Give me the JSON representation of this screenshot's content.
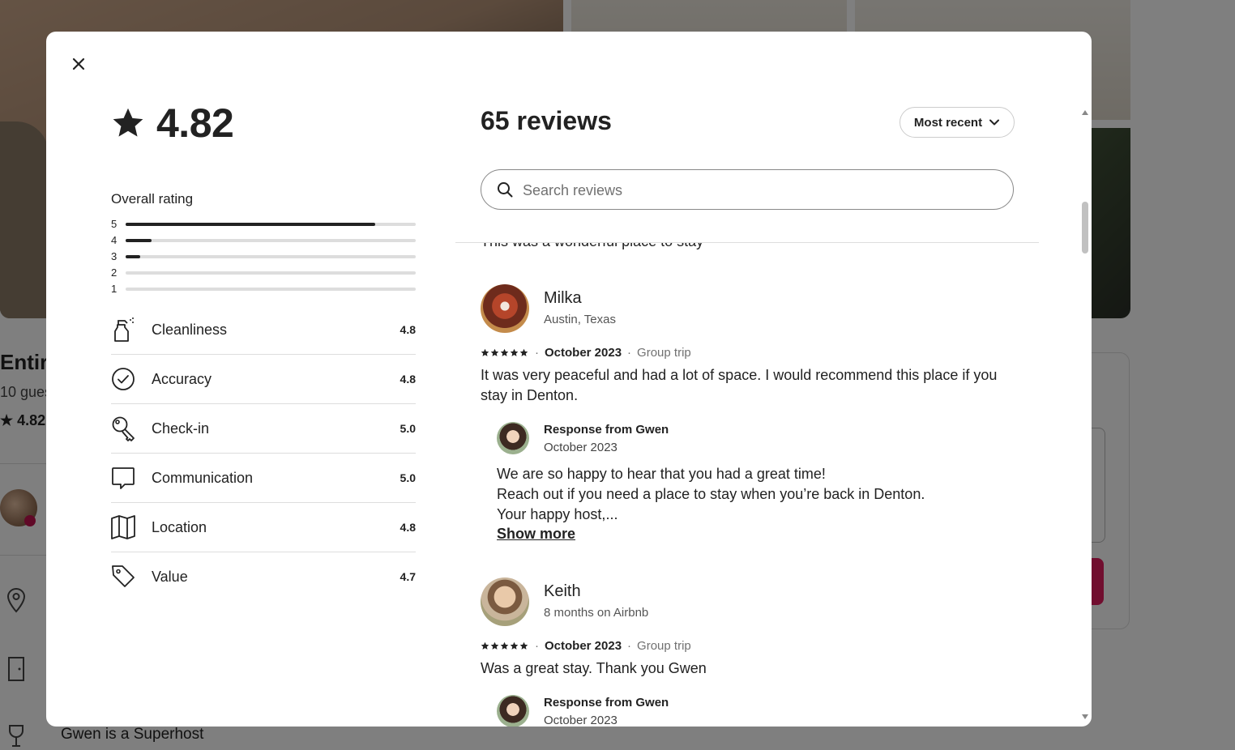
{
  "background": {
    "listing_title": "Entire",
    "listing_sub": "10 gues",
    "listing_rating": "4.82",
    "superhost_text": "Gwen is a Superhost"
  },
  "modal": {
    "overall": {
      "rating": "4.82",
      "label": "Overall rating",
      "histogram": [
        {
          "stars": "5",
          "fraction": 0.86
        },
        {
          "stars": "4",
          "fraction": 0.09
        },
        {
          "stars": "3",
          "fraction": 0.05
        },
        {
          "stars": "2",
          "fraction": 0.0
        },
        {
          "stars": "1",
          "fraction": 0.0
        }
      ]
    },
    "categories": [
      {
        "name": "Cleanliness",
        "value": "4.8",
        "icon": "spray-bottle-icon"
      },
      {
        "name": "Accuracy",
        "value": "4.8",
        "icon": "check-circle-icon"
      },
      {
        "name": "Check-in",
        "value": "5.0",
        "icon": "key-icon"
      },
      {
        "name": "Communication",
        "value": "5.0",
        "icon": "chat-bubble-icon"
      },
      {
        "name": "Location",
        "value": "4.8",
        "icon": "map-icon"
      },
      {
        "name": "Value",
        "value": "4.7",
        "icon": "tag-icon"
      }
    ],
    "reviews_title": "65 reviews",
    "sort_label": "Most recent",
    "search_placeholder": "Search reviews",
    "previous_review_tail": "This was a wonderful place to stay",
    "reviews": [
      {
        "name": "Milka",
        "subtitle": "Austin, Texas",
        "stars": 5,
        "date": "October 2023",
        "trip": "Group trip",
        "text": "It was very peaceful and had a lot of space. I would recommend this place if you stay in Denton.",
        "response": {
          "from": "Response from Gwen",
          "date": "October 2023",
          "lines": [
            "We are so happy to hear that you had a great time!",
            "Reach out if you need a place to stay when you’re back in Denton.",
            "Your happy host,..."
          ],
          "show_more": "Show more"
        }
      },
      {
        "name": "Keith",
        "subtitle": "8 months on Airbnb",
        "stars": 5,
        "date": "October 2023",
        "trip": "Group trip",
        "text": "Was a great stay. Thank you Gwen",
        "response": {
          "from": "Response from Gwen",
          "date": "October 2023"
        }
      }
    ]
  },
  "colors": {
    "overlay": "#000000",
    "text": "#222222",
    "muted": "#717171",
    "divider": "#dddddd",
    "brand": "#e31c5f"
  }
}
